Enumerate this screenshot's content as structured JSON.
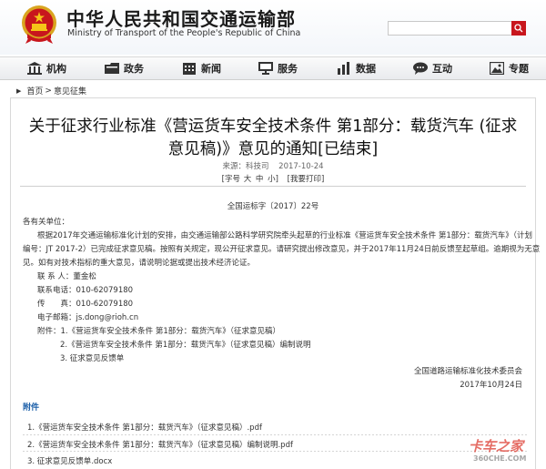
{
  "header": {
    "title": "中华人民共和国交通运输部",
    "subtitle": "Ministry of Transport of the People's Republic of China",
    "search_value": "",
    "accent_color": "#c8161d"
  },
  "nav": {
    "items": [
      {
        "label": "机构",
        "icon": "building-icon"
      },
      {
        "label": "政务",
        "icon": "folder-icon"
      },
      {
        "label": "新闻",
        "icon": "calendar-icon"
      },
      {
        "label": "服务",
        "icon": "monitor-icon"
      },
      {
        "label": "数据",
        "icon": "bar-chart-icon"
      },
      {
        "label": "互动",
        "icon": "chat-icon"
      },
      {
        "label": "专题",
        "icon": "image-icon"
      }
    ]
  },
  "breadcrumb": {
    "home": "首页",
    "separator": ">",
    "current": "意见征集"
  },
  "article": {
    "title_line1": "关于征求行业标准《营运货车安全技术条件 第1部分：载货汽车 (征求",
    "title_line2": "意见稿)》意见的通知[已结束]",
    "source": "来源：科技司",
    "date": "2017-10-24",
    "font_label_open": "[字号",
    "font_large": "大",
    "font_medium": "中",
    "font_small": "小]",
    "print_label": "[我要打印]",
    "doc_number": "全国运标字〔2017〕22号",
    "salutation": "各有关单位：",
    "para1_line1": "根据2017年交通运输标准化计划的安排，由交通运输部公路科学研究院牵头起草的行业标准《营运货车安全技术条件 第1部分：载货汽车》（计划",
    "para1_line2": "编号：JT 2017-2）已完成征求意见稿。按照有关规定，现公开征求意见。请研究提出修改意见，并于2017年11月24日前反馈至起草组。逾期视为无意",
    "para1_line3": "见。如有对技术指标的重大意见，请说明论据或提出技术经济论证。",
    "contact": "联 系 人：董金松",
    "phone": "联系电话：010-62079180",
    "fax": "传　　真：010-62079180",
    "email": "电子邮箱：js.dong@rioh.cn",
    "attach_line1": "附件：1.《营运货车安全技术条件 第1部分：载货汽车》（征求意见稿）",
    "attach_line2": "2.《营运货车安全技术条件 第1部分：载货汽车》（征求意见稿）编制说明",
    "attach_line3": "3. 征求意见反馈单",
    "signature_org": "全国道路运输标准化技术委员会",
    "signature_date": "2017年10月24日"
  },
  "attachments": {
    "heading": "附件",
    "items": [
      "1.《营运货车安全技术条件 第1部分：载货汽车》（征求意见稿）.pdf",
      "2.《营运货车安全技术条件 第1部分：载货汽车》（征求意见稿）编制说明.pdf",
      "3. 征求意见反馈单.docx"
    ]
  },
  "watermark": {
    "cn": "卡车之家",
    "url": "360CHE.COM"
  }
}
